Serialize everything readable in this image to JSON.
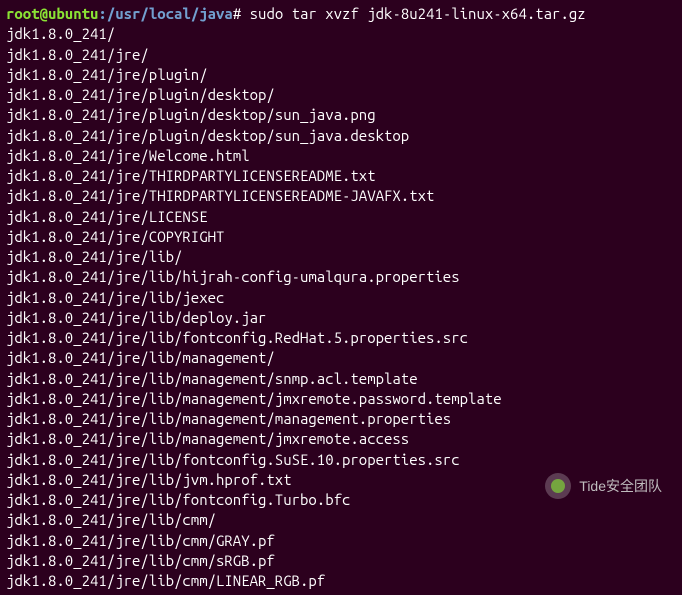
{
  "prompt": {
    "user_host": "root@ubuntu",
    "separator": ":",
    "path": "/usr/local/java",
    "symbol": "# "
  },
  "command": "sudo tar xvzf jdk-8u241-linux-x64.tar.gz",
  "output": [
    "jdk1.8.0_241/",
    "jdk1.8.0_241/jre/",
    "jdk1.8.0_241/jre/plugin/",
    "jdk1.8.0_241/jre/plugin/desktop/",
    "jdk1.8.0_241/jre/plugin/desktop/sun_java.png",
    "jdk1.8.0_241/jre/plugin/desktop/sun_java.desktop",
    "jdk1.8.0_241/jre/Welcome.html",
    "jdk1.8.0_241/jre/THIRDPARTYLICENSEREADME.txt",
    "jdk1.8.0_241/jre/THIRDPARTYLICENSEREADME-JAVAFX.txt",
    "jdk1.8.0_241/jre/LICENSE",
    "jdk1.8.0_241/jre/COPYRIGHT",
    "jdk1.8.0_241/jre/lib/",
    "jdk1.8.0_241/jre/lib/hijrah-config-umalqura.properties",
    "jdk1.8.0_241/jre/lib/jexec",
    "jdk1.8.0_241/jre/lib/deploy.jar",
    "jdk1.8.0_241/jre/lib/fontconfig.RedHat.5.properties.src",
    "jdk1.8.0_241/jre/lib/management/",
    "jdk1.8.0_241/jre/lib/management/snmp.acl.template",
    "jdk1.8.0_241/jre/lib/management/jmxremote.password.template",
    "jdk1.8.0_241/jre/lib/management/management.properties",
    "jdk1.8.0_241/jre/lib/management/jmxremote.access",
    "jdk1.8.0_241/jre/lib/fontconfig.SuSE.10.properties.src",
    "jdk1.8.0_241/jre/lib/jvm.hprof.txt",
    "jdk1.8.0_241/jre/lib/fontconfig.Turbo.bfc",
    "jdk1.8.0_241/jre/lib/cmm/",
    "jdk1.8.0_241/jre/lib/cmm/GRAY.pf",
    "jdk1.8.0_241/jre/lib/cmm/sRGB.pf",
    "jdk1.8.0_241/jre/lib/cmm/LINEAR_RGB.pf"
  ],
  "watermark": {
    "text": "Tide安全团队"
  }
}
